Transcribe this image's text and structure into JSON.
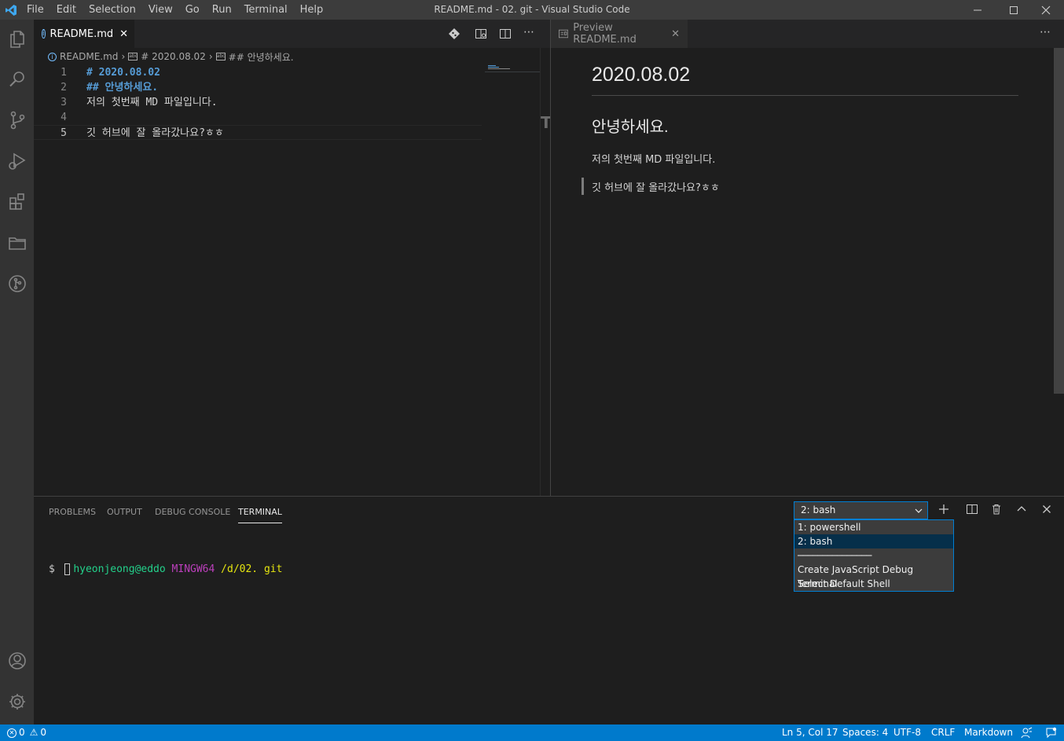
{
  "app": {
    "window_title": "README.md - 02. git - Visual Studio Code",
    "menu": [
      "File",
      "Edit",
      "Selection",
      "View",
      "Go",
      "Run",
      "Terminal",
      "Help"
    ]
  },
  "editor": {
    "tab_label": "README.md",
    "breadcrumb": [
      "README.md",
      "# 2020.08.02",
      "## 안녕하세요."
    ],
    "lines": [
      {
        "n": "1",
        "text": "# 2020.08.02"
      },
      {
        "n": "2",
        "text": "## 안녕하세요."
      },
      {
        "n": "3",
        "text": "저의 첫번째 MD 파일입니다."
      },
      {
        "n": "4",
        "text": ""
      },
      {
        "n": "5",
        "text": "깃 허브에 잘 올라갔나요?ㅎㅎ"
      }
    ],
    "cursor_glyph": "T"
  },
  "preview": {
    "tab_label": "Preview README.md",
    "h1": "2020.08.02",
    "h2": "안녕하세요.",
    "paragraph": "저의 첫번째 MD 파일입니다.",
    "blockquote": "깃 허브에 잘 올라갔나요?ㅎㅎ"
  },
  "panel": {
    "tabs": [
      "PROBLEMS",
      "OUTPUT",
      "DEBUG CONSOLE",
      "TERMINAL"
    ],
    "active_tab": "TERMINAL",
    "terminal": {
      "user": "hyeonjeong@eddo",
      "system": "MINGW64",
      "path": "/d/02. git",
      "prompt": "$"
    },
    "shell_select": {
      "selected": "2: bash",
      "options": [
        "1: powershell",
        "2: bash",
        "───────────────",
        "Create JavaScript Debug Terminal",
        "Select Default Shell"
      ]
    }
  },
  "statusbar": {
    "errors": "0",
    "warnings": "0",
    "position": "Ln 5, Col 17",
    "spaces": "Spaces: 4",
    "encoding": "UTF-8",
    "eol": "CRLF",
    "language": "Markdown"
  },
  "colors": {
    "accent": "#007acc",
    "heading": "#569cd6",
    "terminal_green": "#23d18b",
    "terminal_magenta": "#bc3fbc",
    "terminal_yellow": "#e5e510"
  }
}
